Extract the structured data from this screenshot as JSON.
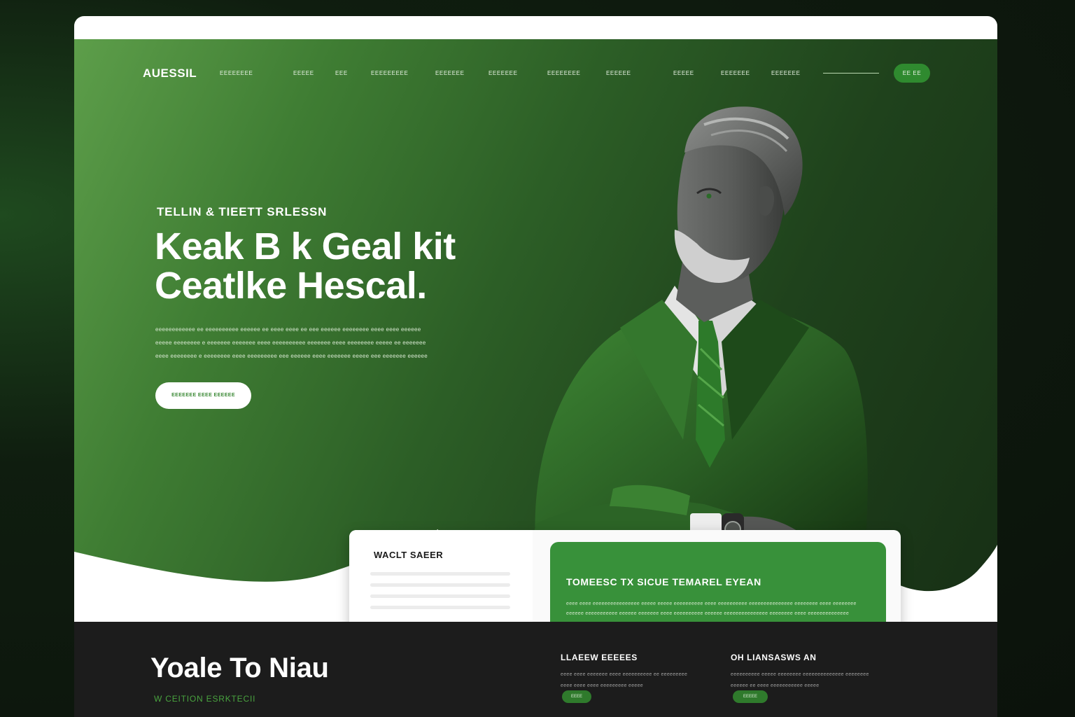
{
  "brand": {
    "logo": "AUESSIL",
    "tagline": "EEEEEEEE"
  },
  "nav": {
    "links": [
      "EEEEE",
      "EEE",
      "EEEEEEEEE",
      "EEEEEEE",
      "EEEEEEE",
      "EEEEEEEE",
      "EEEEEE",
      "EEEEE",
      "EEEEEEE",
      "EEEEEEE"
    ],
    "cta_label": "EE EE"
  },
  "hero": {
    "kicker": "TELLIN & TIEETT SRLESSN",
    "headline_line1": "Keak B k Geal kit",
    "headline_line2": "Ceatlke  Hescal.",
    "paragraph_lines": [
      "eeeeeeeeeeee ee eeeeeeeeee eeeeee ee eeee eeee ee eee eeeeee eeeeeeee eeee eeee eeeeee",
      "eeeee eeeeeeee e eeeeeee eeeeeee eeee eeeeeeeeee eeeeeee eeee eeeeeeee eeeee ee eeeeeee",
      "eeee eeeeeeee e eeeeeeee eeee eeeeeeeee eee eeeeee eeee eeeeeee eeeee eee eeeeeee eeeeee"
    ],
    "cta_label": "EEEEEEE EEEE EEEEEE"
  },
  "card_left": {
    "title": "WACLT  SAEER"
  },
  "card_right": {
    "title": "TOMEESC  TX  SICUE  TEMAREL  EYEAN",
    "text_lines": [
      "eeee eeee eeeeeeeeeeeeeeee eeeee eeeee eeeeeeeeee eeee eeeeeeeeee eeeeeeeeeeeeeee eeeeeeee eeee eeeeeeee",
      "eeeeee eeeeeeeeeee eeeeee eeeeeee eeee eeeeeeeeee eeeeee eeeeeeeeeeeeeee eeeeeeee eeee eeeeeeeeeeeeee"
    ]
  },
  "footer": {
    "title": "Yoale To Niau",
    "subtitle": "W CEITION ESRKTECII",
    "col1": {
      "title": "LLAEEW  EEEEES",
      "lines": [
        "eeee eeee eeeeeee eeee eeeeeeeeee ee eeeeeeeee",
        "eeee eeee eeee eeeeeeeee eeeee"
      ],
      "button": "EEEE"
    },
    "col2": {
      "title": "OH LIANSASWS  AN",
      "lines": [
        "eeeeeeeeee eeeee eeeeeeee eeeeeeeeeeeeee eeeeeeee",
        "eeeeee ee eeee eeeeeeeeeee eeeee"
      ],
      "button": "EEEEE"
    }
  },
  "colors": {
    "accent_green": "#38913a",
    "hero_green": "#3f7d33",
    "footer_bg": "#1c1c1c",
    "outer_bg": "#0f1d0f"
  },
  "icons": {
    "portrait": "businessman-portrait-illustration"
  }
}
